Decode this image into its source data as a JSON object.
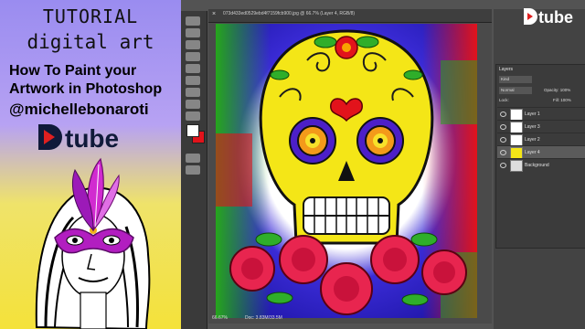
{
  "promo": {
    "line1": "TUTORIAL",
    "line2": "digital art",
    "heading": "How To Paint your Artwork in Photoshop",
    "handle": "@michellebonaroti",
    "logo_text": "tube"
  },
  "photoshop": {
    "doc_tab_title": "073d433ed0529ebd4f7159fcb900.jpg @ 66.7% (Layer 4, RGB/8)",
    "zoom": "66.67%",
    "doc_size": "Doc: 3.83M/33.5M",
    "fg_color": "#ffffff",
    "bg_color": "#e2131b",
    "logo_text": "tube",
    "layers": {
      "title": "Layers",
      "kind": "Kind",
      "mode": "Normal",
      "opacity": "Opacity: 100%",
      "lock": "Lock:",
      "fill": "Fill: 100%",
      "rows": [
        {
          "name": "Layer 1",
          "visible": true,
          "active": false
        },
        {
          "name": "Layer 3",
          "visible": true,
          "active": false
        },
        {
          "name": "Layer 2",
          "visible": true,
          "active": false
        },
        {
          "name": "Layer 4",
          "visible": true,
          "active": true
        },
        {
          "name": "Background",
          "visible": true,
          "active": false
        }
      ]
    }
  }
}
